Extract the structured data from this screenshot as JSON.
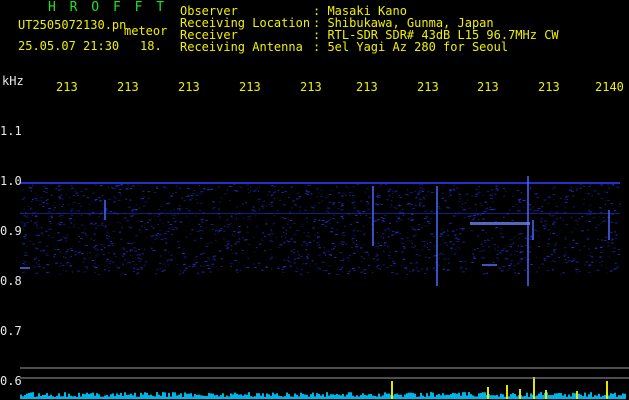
{
  "header": {
    "brand": "H R O F F T",
    "filename": "UT2505072130.pn",
    "tag": "meteor",
    "datetime": "25.05.07 21:30",
    "count": "18.",
    "fields": [
      {
        "label": "Observer",
        "value": ": Masaki Kano"
      },
      {
        "label": "Receiving Location",
        "value": ": Shibukawa, Gunma, Japan"
      },
      {
        "label": "Receiver",
        "value": ": RTL-SDR SDR# 43dB L15 96.7MHz CW"
      },
      {
        "label": "Receiving Antenna",
        "value": ": 5el Yagi Az 280 for Seoul"
      }
    ]
  },
  "axis": {
    "y_unit": "kHz",
    "y_ticks": [
      "1.1",
      "1.0",
      "0.9",
      "0.8",
      "0.7",
      "0.6"
    ],
    "x_ticks": [
      "213",
      "213",
      "213",
      "213",
      "213",
      "213",
      "213",
      "213",
      "213",
      "2140"
    ]
  },
  "colors": {
    "background": "#000000",
    "header_green": "#22e022",
    "header_yellow": "#f0f000",
    "header_white": "#e8e8e8",
    "signal_blue": "#2a3cff",
    "spectrum_cyan": "#00c8ff",
    "spectrum_yellow": "#f0f000"
  }
}
